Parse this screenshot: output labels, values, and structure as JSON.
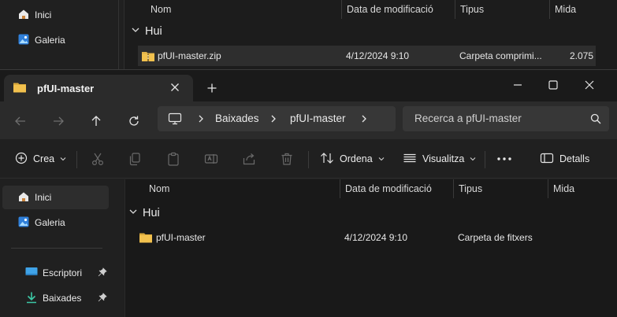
{
  "background_window": {
    "nav": [
      {
        "label": "Inici",
        "icon": "home-icon"
      },
      {
        "label": "Galeria",
        "icon": "gallery-icon"
      }
    ],
    "columns": [
      "Nom",
      "Data de modificació",
      "Tipus",
      "Mida"
    ],
    "group": "Hui",
    "file": {
      "name": "pfUI-master.zip",
      "date": "4/12/2024 9:10",
      "type": "Carpeta comprimi...",
      "size": "2.075"
    }
  },
  "window": {
    "tab_title": "pfUI-master",
    "breadcrumb": [
      "Baixades",
      "pfUI-master"
    ],
    "search_placeholder": "Recerca a pfUI-master",
    "toolbar": {
      "new_label": "Crea",
      "sort_label": "Ordena",
      "view_label": "Visualitza",
      "details_label": "Detalls"
    },
    "nav": {
      "items": [
        {
          "label": "Inici",
          "icon": "home-icon",
          "selected": true
        },
        {
          "label": "Galeria",
          "icon": "gallery-icon"
        }
      ],
      "pinned": [
        {
          "label": "Escriptori",
          "icon": "desktop-icon"
        },
        {
          "label": "Baixades",
          "icon": "download-icon"
        }
      ]
    },
    "columns": [
      "Nom",
      "Data de modificació",
      "Tipus",
      "Mida"
    ],
    "group": "Hui",
    "files": [
      {
        "name": "pfUI-master",
        "date": "4/12/2024 9:10",
        "type": "Carpeta de fitxers",
        "size": ""
      }
    ]
  },
  "colors": {
    "folder": "#f2c14e",
    "accent": "#4ea1f3",
    "download": "#3cc9a6"
  }
}
